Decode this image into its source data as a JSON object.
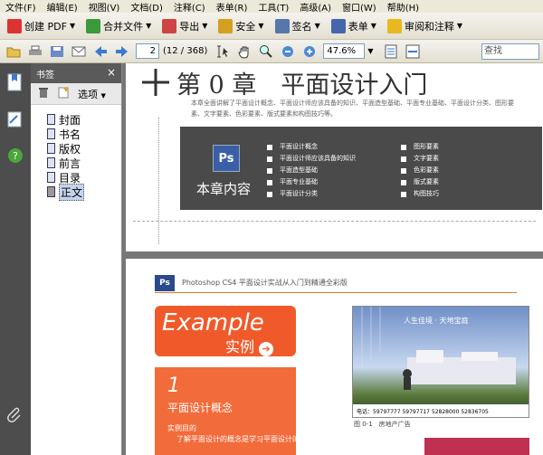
{
  "menu": [
    "文件(F)",
    "编辑(E)",
    "视图(V)",
    "文档(D)",
    "注释(C)",
    "表单(R)",
    "工具(T)",
    "高级(A)",
    "窗口(W)",
    "帮助(H)"
  ],
  "toolbar": {
    "create_pdf": "创建 PDF",
    "merge": "合并文件",
    "export": "导出",
    "security": "安全",
    "sign": "签名",
    "forms": "表单",
    "review": "审阅和注释"
  },
  "nav": {
    "page_current": "2",
    "page_total": "(12 / 368)",
    "zoom": "47.6%",
    "search_placeholder": "查找"
  },
  "bookmarks": {
    "title": "书签",
    "options": "选项",
    "items": [
      "封面",
      "书名",
      "版权",
      "前言",
      "目录",
      "正文"
    ]
  },
  "page1": {
    "chapter_title": "第 0 章　平面设计入门",
    "intro": "本章全面讲解了平面设计概念、平面设计师应该具备的知识、平面造型基础、平面专业基础、平面设计分类、图形要素、文字要素、色彩要素、版式要素和构图技巧等。",
    "box_label": "本章内容",
    "left_list": [
      "平面设计概念",
      "平面设计师应该具备的知识",
      "平面造型基础",
      "平面专业基础",
      "平面设计分类"
    ],
    "right_list": [
      "图形要素",
      "文字要素",
      "色彩要素",
      "版式要素",
      "构图技巧"
    ]
  },
  "page2": {
    "header": "Photoshop CS4 平面设计实战从入门到精通全彩版",
    "example_en": "Example",
    "example_cn": "实例",
    "section_num": "1",
    "section_title": "平面设计概念",
    "section_sub": "实例目的",
    "section_body": "了解平面设计的概念是学习平面设计的",
    "ad_text": "人生佳境 · 天地宝庭",
    "ad_tel": "电话：59797777  59797717  52828000  52836705",
    "fig_caption": "图 0-1　房地产广告"
  }
}
